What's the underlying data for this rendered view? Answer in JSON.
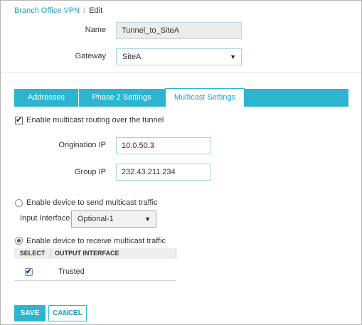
{
  "breadcrumb": {
    "parent": "Branch Office VPN",
    "separator": "/",
    "current": "Edit"
  },
  "form": {
    "name_label": "Name",
    "name_value": "Tunnel_to_SiteA",
    "gateway_label": "Gateway",
    "gateway_value": "SiteA"
  },
  "tabs": [
    {
      "label": "Addresses",
      "active": false
    },
    {
      "label": "Phase 2 Settings",
      "active": false
    },
    {
      "label": "Multicast Settings",
      "active": true
    }
  ],
  "multicast": {
    "enable_routing_label": "Enable multicast routing over the tunnel",
    "enable_routing_checked": true,
    "origination_ip_label": "Origination IP",
    "origination_ip_value": "10.0.50.3",
    "group_ip_label": "Group IP",
    "group_ip_value": "232.43.211.234",
    "send_option_label": "Enable device to send multicast traffic",
    "input_interface_label": "Input Interface",
    "input_interface_value": "Optional-1",
    "receive_option_label": "Enable device to receive multicast traffic",
    "selected_option": "receive"
  },
  "output_table": {
    "columns": [
      "SELECT",
      "OUTPUT INTERFACE"
    ],
    "rows": [
      {
        "selected": true,
        "interface": "Trusted"
      }
    ]
  },
  "actions": {
    "save_label": "SAVE",
    "cancel_label": "CANCEL"
  },
  "colors": {
    "accent": "#2db5cf",
    "link": "#1a9fc0"
  },
  "icons": {
    "dropdown": "chevron-down-icon",
    "check": "check-icon"
  }
}
